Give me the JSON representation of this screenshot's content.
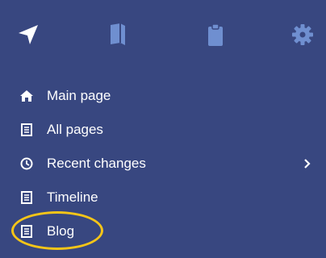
{
  "toolbar": {
    "icons": [
      "navigation-icon",
      "book-icon",
      "clipboard-icon",
      "gear-icon"
    ]
  },
  "menu": {
    "items": [
      {
        "label": "Main page",
        "icon": "home-icon"
      },
      {
        "label": "All pages",
        "icon": "document-icon"
      },
      {
        "label": "Recent changes",
        "icon": "clock-icon",
        "has_submenu": true
      },
      {
        "label": "Timeline",
        "icon": "document-icon"
      },
      {
        "label": "Blog",
        "icon": "document-icon",
        "highlighted": true
      }
    ]
  },
  "colors": {
    "background": "#384780",
    "toolbar_icons": "#6f8fd0",
    "text": "#ffffff",
    "highlight": "#f5c518"
  }
}
